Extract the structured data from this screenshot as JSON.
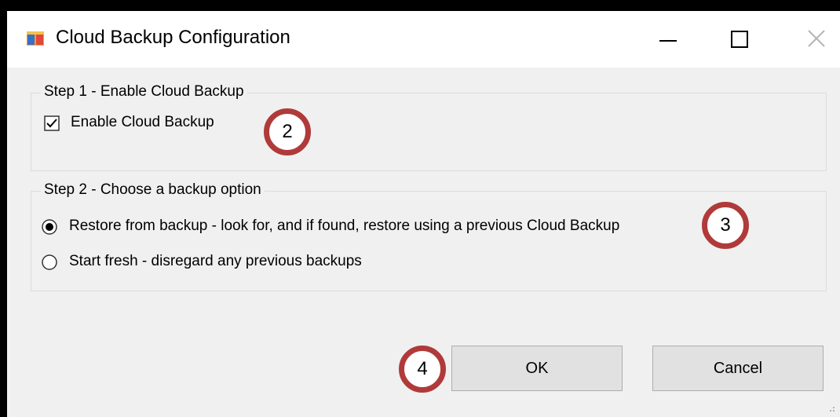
{
  "window": {
    "title": "Cloud Backup Configuration",
    "icon": "app-window-icon",
    "controls": [
      "minimize-icon",
      "maximize-icon",
      "close-icon"
    ]
  },
  "step1": {
    "title": "Step 1 - Enable Cloud Backup",
    "checkbox_label": "Enable Cloud Backup",
    "checked": true
  },
  "step2": {
    "title": "Step 2 - Choose a backup option",
    "options": [
      {
        "label": "Restore from backup - look for, and if found, restore using a previous Cloud Backup",
        "selected": true
      },
      {
        "label": "Start fresh - disregard any previous backups",
        "selected": false
      }
    ]
  },
  "buttons": {
    "ok_label": "OK",
    "cancel_label": "Cancel"
  },
  "annotations": {
    "badge_2": "2",
    "badge_3": "3",
    "badge_4": "4",
    "color": "#b03a3a"
  }
}
